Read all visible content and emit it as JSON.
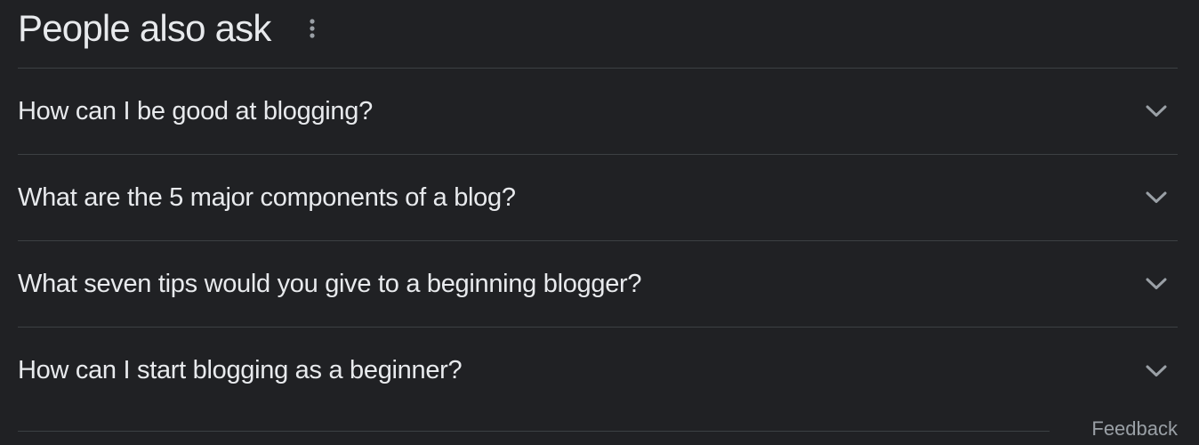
{
  "section": {
    "title": "People also ask",
    "menu_icon": "more-vert-icon"
  },
  "questions": [
    {
      "text": "How can I be good at blogging?",
      "icon": "chevron-down-icon"
    },
    {
      "text": "What are the 5 major components of a blog?",
      "icon": "chevron-down-icon"
    },
    {
      "text": "What seven tips would you give to a beginning blogger?",
      "icon": "chevron-down-icon"
    },
    {
      "text": "How can I start blogging as a beginner?",
      "icon": "chevron-down-icon"
    }
  ],
  "footer": {
    "feedback_label": "Feedback"
  },
  "colors": {
    "background": "#202124",
    "text": "#e8eaed",
    "muted_text": "#9aa0a6",
    "divider": "#3c4043"
  }
}
